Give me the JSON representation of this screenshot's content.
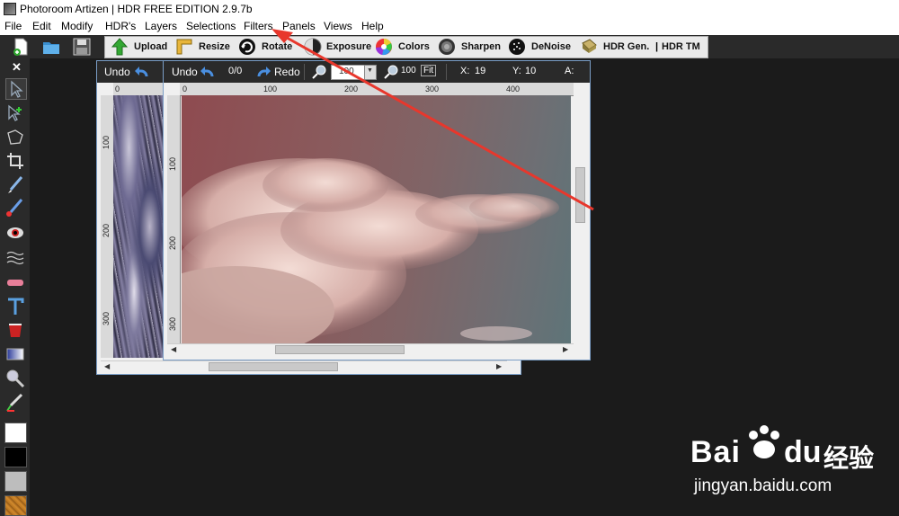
{
  "app": {
    "title": "Photoroom Artizen | HDR FREE EDITION 2.9.7b"
  },
  "menu": [
    "File",
    "Edit",
    "Modify",
    "HDR's",
    "Layers",
    "Selections",
    "Filters",
    "Panels",
    "Views",
    "Help"
  ],
  "toolbar": {
    "upload": "Upload",
    "resize": "Resize",
    "rotate": "Rotate",
    "exposure": "Exposure",
    "colors": "Colors",
    "sharpen": "Sharpen",
    "denoise": "DeNoise",
    "hdr_gen": "HDR Gen.",
    "sep": "|",
    "hdr_tm": "HDR TM"
  },
  "left_panel": {
    "close": "✕"
  },
  "back_window": {
    "undo": "Undo",
    "ruler_h": [
      "0"
    ],
    "ruler_v": [
      "100",
      "200",
      "300"
    ]
  },
  "front_window": {
    "undo": "Undo",
    "history": "0/0",
    "redo": "Redo",
    "zoom_value": "100",
    "zoom_100": "100",
    "fit": "Fit",
    "x_label": "X:",
    "x_value": "19",
    "y_label": "Y:",
    "y_value": "10",
    "a_label": "A:",
    "ruler_h": [
      "0",
      "100",
      "200",
      "300",
      "400"
    ],
    "ruler_v": [
      "100",
      "200",
      "300"
    ]
  },
  "watermark": {
    "brand": "Bai",
    "brand2": "du",
    "cn": "经验",
    "url": "jingyan.baidu.com"
  },
  "colors": {
    "primary_swatch": "#ffffff",
    "secondary_swatch": "#000000",
    "annotation_arrow": "#e8372c"
  }
}
